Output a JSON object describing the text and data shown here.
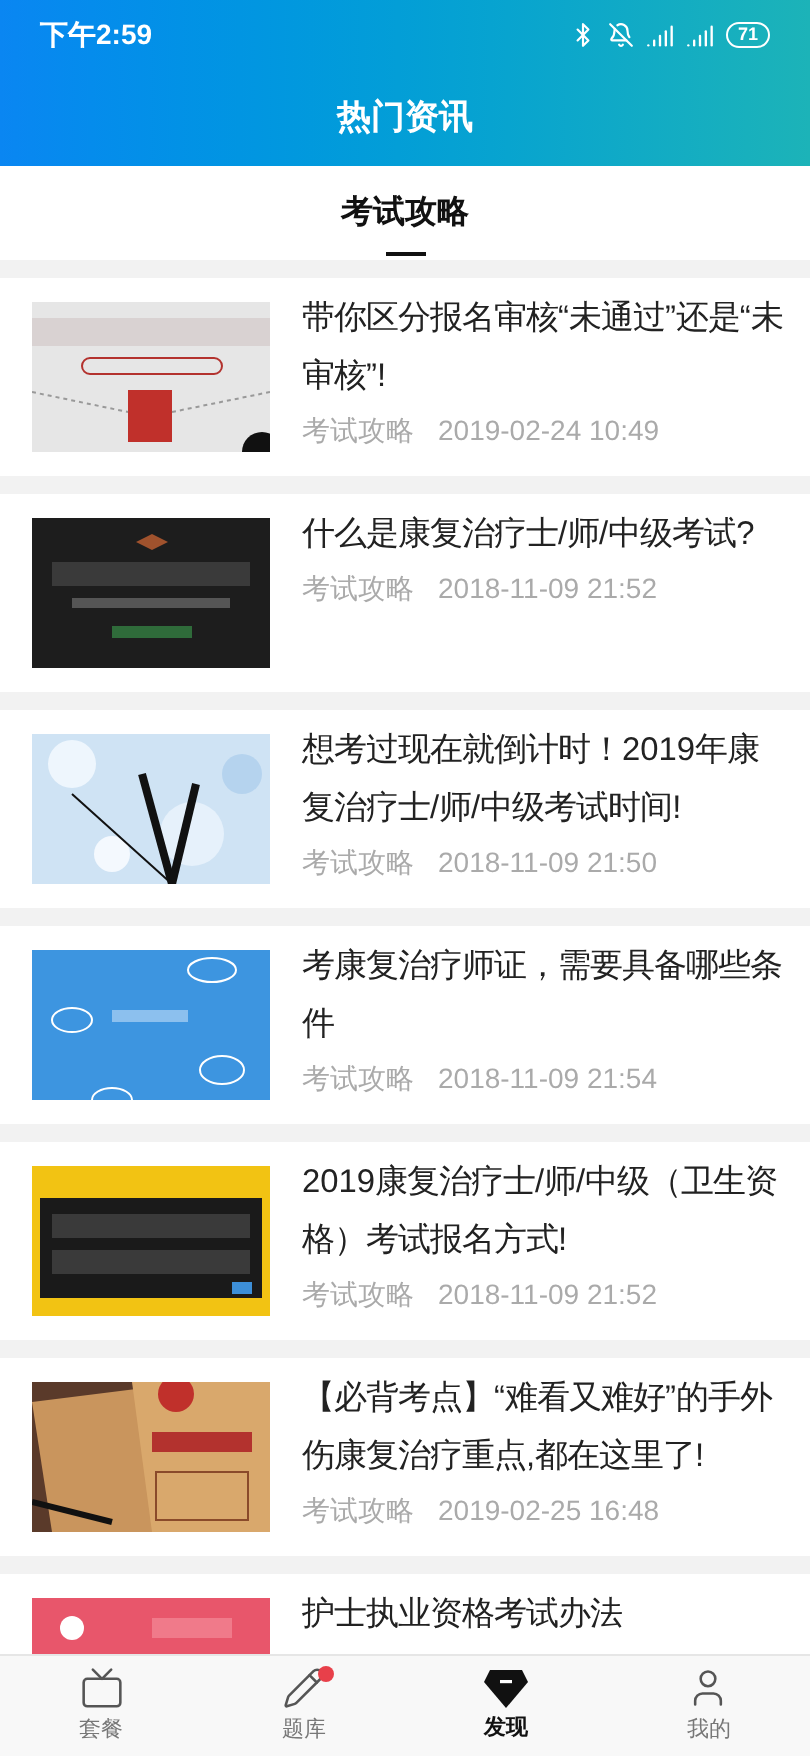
{
  "status_bar": {
    "time": "下午2:59",
    "battery": "71"
  },
  "header": {
    "title": "热门资讯"
  },
  "tabs": [
    {
      "label": "考试攻略",
      "selected": true
    }
  ],
  "articles": [
    {
      "title": "带你区分报名审核“未通过”还是“未审核”!",
      "category": "考试攻略",
      "date": "2019-02-24 10:49"
    },
    {
      "title": "什么是康复治疗士/师/中级考试?",
      "category": "考试攻略",
      "date": "2018-11-09 21:52"
    },
    {
      "title": "想考过现在就倒计时！2019年康复治疗士/师/中级考试时间!",
      "category": "考试攻略",
      "date": "2018-11-09 21:50"
    },
    {
      "title": "考康复治疗师证，需要具备哪些条件",
      "category": "考试攻略",
      "date": "2018-11-09 21:54"
    },
    {
      "title": "2019康复治疗士/师/中级（卫生资格）考试报名方式!",
      "category": "考试攻略",
      "date": "2018-11-09 21:52"
    },
    {
      "title": "【必背考点】“难看又难好”的手外伤康复治疗重点,都在这里了!",
      "category": "考试攻略",
      "date": "2019-02-25 16:48"
    },
    {
      "title": "护士执业资格考试办法"
    }
  ],
  "bottom_nav": [
    {
      "label": "套餐",
      "selected": false,
      "badge": false
    },
    {
      "label": "题库",
      "selected": false,
      "badge": true
    },
    {
      "label": "发现",
      "selected": true,
      "badge": false
    },
    {
      "label": "我的",
      "selected": false,
      "badge": false
    }
  ]
}
